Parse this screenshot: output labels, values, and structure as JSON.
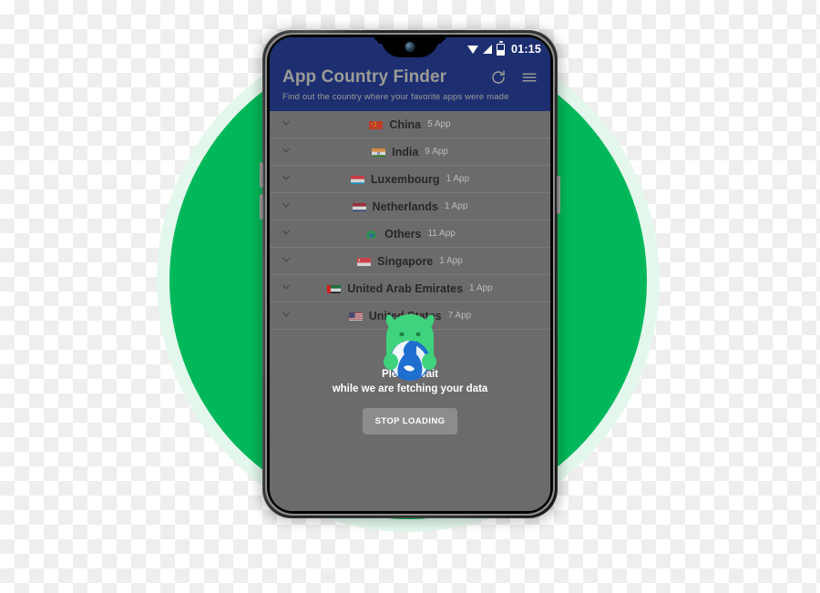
{
  "app": {
    "title": "App Country Finder",
    "subtitle": "Find out the country where your favorite apps were made",
    "appbar_color": "#1d2f71",
    "brand_green": "#00b85a"
  },
  "status_bar": {
    "clock": "01:15",
    "icons": [
      "wifi-icon",
      "signal-icon",
      "battery-icon"
    ]
  },
  "appbar_actions": [
    {
      "name": "refresh-icon",
      "label": "Refresh"
    },
    {
      "name": "menu-icon",
      "label": "Menu"
    }
  ],
  "countries": [
    {
      "name": "China",
      "count": "5 App",
      "flag": "cn"
    },
    {
      "name": "India",
      "count": "9 App",
      "flag": "in"
    },
    {
      "name": "Luxembourg",
      "count": "1 App",
      "flag": "lu"
    },
    {
      "name": "Netherlands",
      "count": "1 App",
      "flag": "nl"
    },
    {
      "name": "Others",
      "count": "11 App",
      "flag": "globe"
    },
    {
      "name": "Singapore",
      "count": "1 App",
      "flag": "sg"
    },
    {
      "name": "United Arab Emirates",
      "count": "1 App",
      "flag": "ae"
    },
    {
      "name": "United States",
      "count": "7 App",
      "flag": "us"
    }
  ],
  "loading": {
    "line1": "Please wait",
    "line2": "while we are fetching your data",
    "stop_button": "STOP LOADING"
  }
}
